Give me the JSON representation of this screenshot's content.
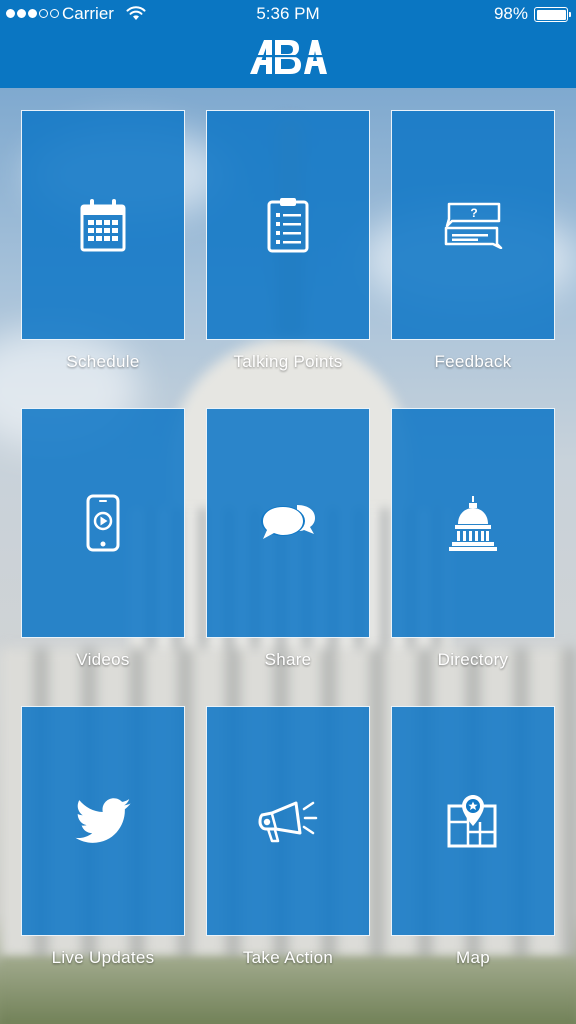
{
  "status_bar": {
    "carrier": "Carrier",
    "time": "5:36 PM",
    "battery_percent": "98%",
    "signal_bars_filled": 3,
    "signal_bars_total": 5
  },
  "header": {
    "logo_text": "ABA",
    "background_color": "#0a76c2"
  },
  "tiles": [
    {
      "label": "Schedule",
      "icon": "calendar-icon"
    },
    {
      "label": "Talking Points",
      "icon": "clipboard-icon"
    },
    {
      "label": "Feedback",
      "icon": "chat-question-icon"
    },
    {
      "label": "Videos",
      "icon": "phone-play-icon"
    },
    {
      "label": "Share",
      "icon": "speech-bubbles-icon"
    },
    {
      "label": "Directory",
      "icon": "capitol-icon"
    },
    {
      "label": "Live Updates",
      "icon": "twitter-bird-icon"
    },
    {
      "label": "Take Action",
      "icon": "megaphone-icon"
    },
    {
      "label": "Map",
      "icon": "map-pin-icon"
    }
  ],
  "colors": {
    "tile": "#1178c6",
    "tile_border": "#ffffff",
    "label_text": "#ffffff"
  }
}
